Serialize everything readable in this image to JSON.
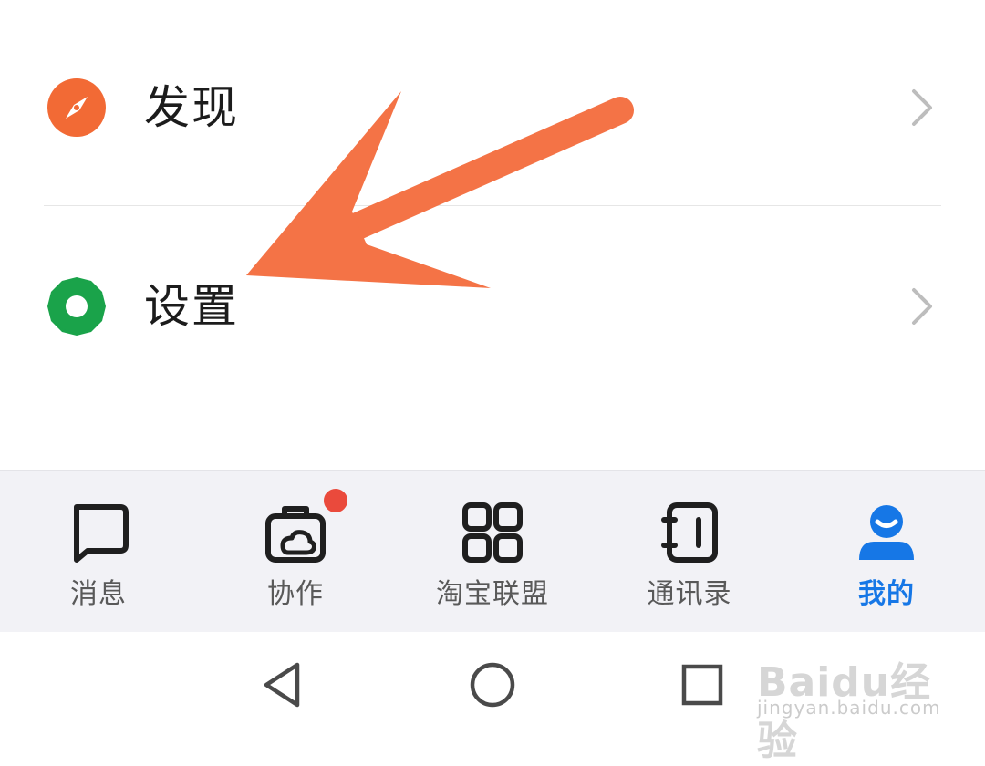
{
  "menu": {
    "items": [
      {
        "label": "发现",
        "icon": "compass-icon",
        "color": "#f26a35"
      },
      {
        "label": "设置",
        "icon": "gear-icon",
        "color": "#1aa34a"
      }
    ]
  },
  "annotation": {
    "arrow_color": "#f47346"
  },
  "tabbar": {
    "tabs": [
      {
        "label": "消息",
        "icon": "message-icon",
        "active": false
      },
      {
        "label": "协作",
        "icon": "collaborate-icon",
        "active": false,
        "badge": true
      },
      {
        "label": "淘宝联盟",
        "icon": "grid-icon",
        "active": false
      },
      {
        "label": "通讯录",
        "icon": "contacts-icon",
        "active": false
      },
      {
        "label": "我的",
        "icon": "profile-icon",
        "active": true
      }
    ],
    "active_color": "#1677e6",
    "badge_color": "#ea4a3c"
  },
  "system_nav": [
    "back-icon",
    "home-icon",
    "recents-icon"
  ],
  "watermark": {
    "brand": "Baidu经验",
    "url": "jingyan.baidu.com"
  }
}
